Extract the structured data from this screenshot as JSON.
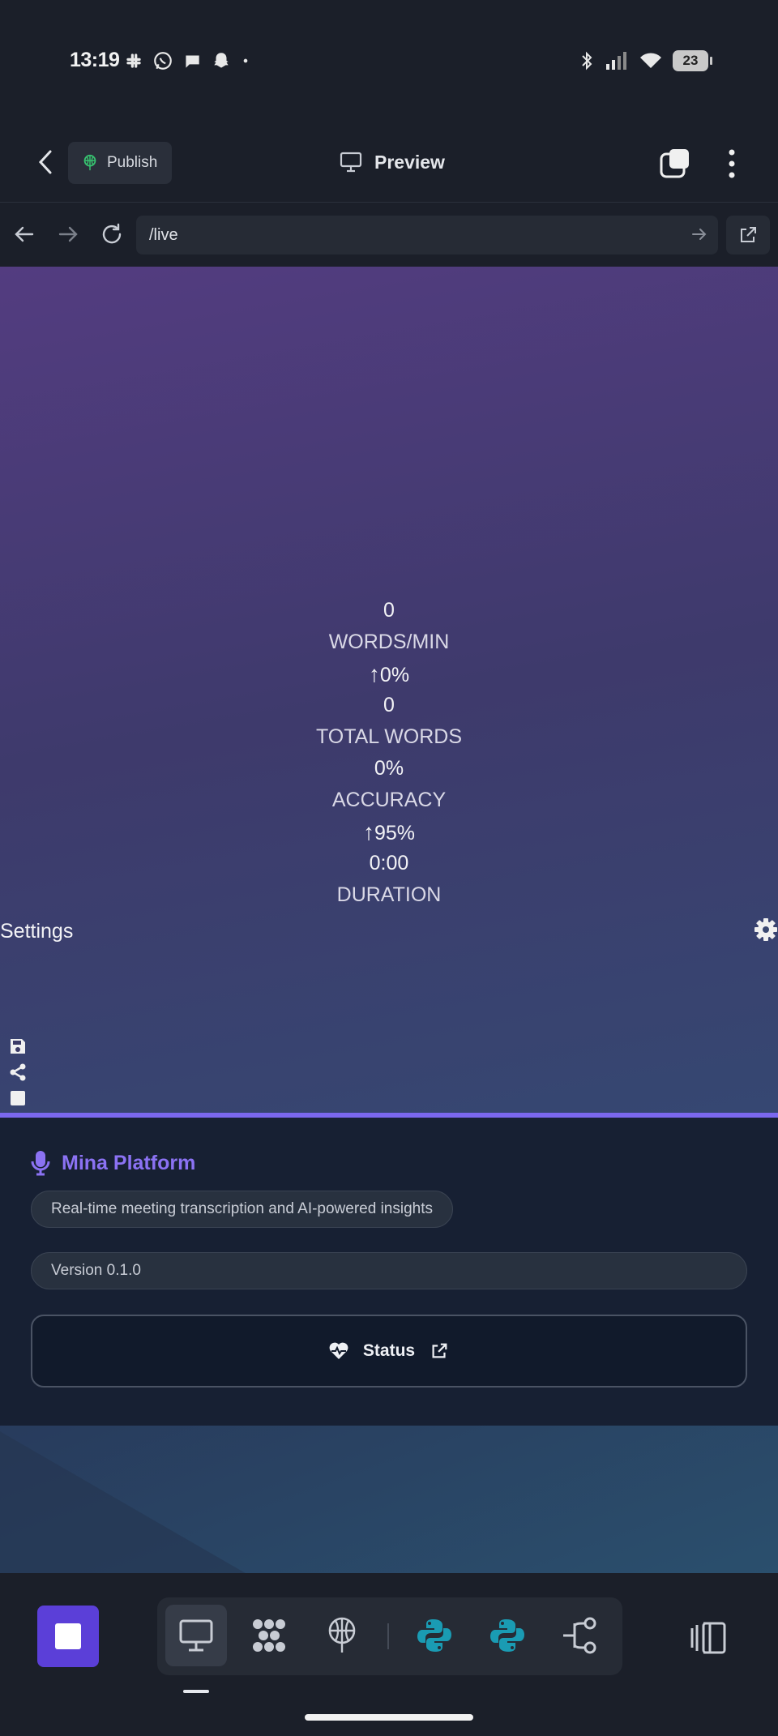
{
  "status_bar": {
    "time": "13:19",
    "notification_icons": [
      "slack-icon",
      "whatsapp-icon",
      "messages-icon",
      "snapchat-icon",
      "dot-icon"
    ],
    "system_icons": [
      "bluetooth-icon",
      "signal-icon",
      "wifi-icon"
    ],
    "battery": "23"
  },
  "header": {
    "publish_label": "Publish",
    "title": "Preview"
  },
  "url_bar": {
    "url": "/live"
  },
  "preview": {
    "stats": [
      {
        "value": "0",
        "label": "WORDS/MIN",
        "trend": "0%"
      },
      {
        "value": "0",
        "label": "TOTAL WORDS"
      },
      {
        "value": "0%",
        "label": "ACCURACY",
        "trend": "95%"
      },
      {
        "value": "0:00",
        "label": "DURATION"
      }
    ],
    "settings_label": "Settings",
    "footer": {
      "brand": "Mina Platform",
      "tagline": "Real-time meeting transcription and AI-powered insights",
      "version": "Version 0.1.0",
      "status_label": "Status"
    }
  },
  "colors": {
    "accent": "#7b68ee",
    "brand_text": "#8b72f3",
    "stop_button": "#5b3fd8",
    "python_teal": "#1a9bb3"
  },
  "toolbar": {
    "tools": [
      "desktop-icon",
      "dots-grid-icon",
      "deploy-icon",
      "python-icon",
      "python-icon",
      "git-branch-icon"
    ],
    "active_tool": "desktop-icon"
  }
}
